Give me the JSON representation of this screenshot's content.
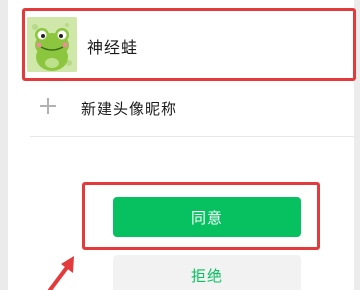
{
  "profile": {
    "name": "神经蛙",
    "avatar_icon": "frog-avatar-icon"
  },
  "add_nickname": {
    "label": "新建头像昵称",
    "icon": "plus-icon"
  },
  "actions": {
    "agree_label": "同意",
    "reject_label": "拒绝"
  },
  "colors": {
    "highlight": "#e33b3b",
    "primary_green": "#07c160",
    "secondary_bg": "#f2f2f2"
  }
}
